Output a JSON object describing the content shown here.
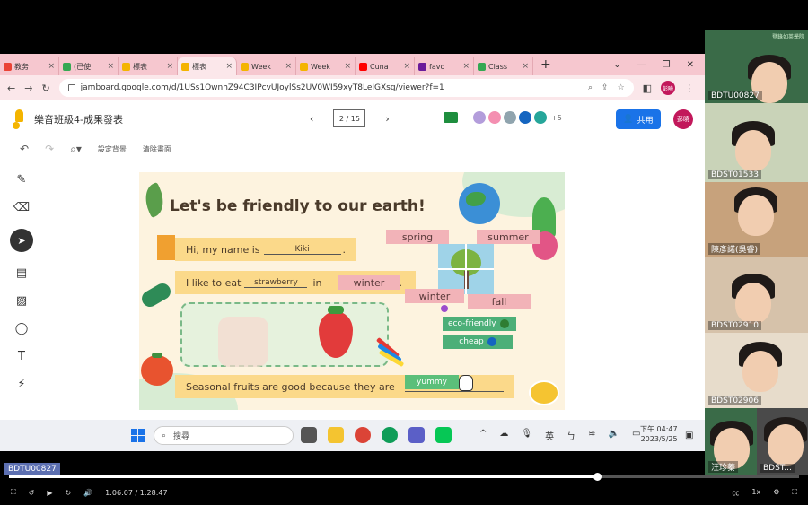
{
  "tabs": [
    {
      "label": "教务",
      "color": "#ea4335"
    },
    {
      "label": "(已使",
      "color": "#34a853"
    },
    {
      "label": "標表",
      "color": "#f4b400"
    },
    {
      "label": "標表",
      "color": "#f4b400",
      "active": true
    },
    {
      "label": "Week",
      "color": "#f4b400"
    },
    {
      "label": "Week",
      "color": "#f4b400"
    },
    {
      "label": "Cuna",
      "color": "#ff0000"
    },
    {
      "label": "favo",
      "color": "#6a1b9a"
    },
    {
      "label": "Class",
      "color": "#34a853"
    }
  ],
  "browser": {
    "url": "jamboard.google.com/d/1USs1OwnhZ94C3IPcvUJoylSs2UV0WI59xyT8LeIGXsg/viewer?f=1",
    "new_tab": "+",
    "account": "彭曉"
  },
  "app": {
    "doc_title": "樂音班級4-成果發表",
    "page_indicator": "2 / 15",
    "extra_collaborators": "+5",
    "share_label": "共用",
    "account": "彭曉",
    "set_background": "設定背景",
    "clear_frame": "清除畫面"
  },
  "frame": {
    "headline": "Let's be friendly to our earth!",
    "line1_prefix": "Hi, my name is",
    "line1_value": "Kiki",
    "line2_prefix": "I like to eat",
    "line2_value": "strawberry",
    "line2_mid": "in",
    "line2_season": "winter",
    "line3_prefix": "Seasonal fruits are good because they are",
    "line3_value": "yummy",
    "seasons": {
      "spring": "spring",
      "summer": "summer",
      "winter": "winter",
      "fall": "fall"
    },
    "eco_friendly": "eco-friendly",
    "cheap": "cheap",
    "dot": "."
  },
  "taskbar": {
    "search_placeholder": "搜尋",
    "lang": "英",
    "time": "下午 04:47",
    "date": "2023/5/25"
  },
  "participants": [
    {
      "name": "BDTU00827",
      "bg": "#3a6b48",
      "brand": "登錄如英學院"
    },
    {
      "name": "BDST01533",
      "bg": "#c9d3b8"
    },
    {
      "name": "陳彥諾(吳睿)",
      "bg": "#c7a27c"
    },
    {
      "name": "BDST02910",
      "bg": "#d6c2aa"
    },
    {
      "name": "BDST02906",
      "bg": "#e7dccb"
    },
    {
      "name": "汪珍蓁",
      "bg": "#3a6b48"
    },
    {
      "name": "BDST...",
      "bg": "#4a4a4a"
    }
  ],
  "player": {
    "speaker_tag": "BDTU00827",
    "time": "1:06:07 / 1:28:47",
    "speed": "1x",
    "progress": 0.744
  }
}
